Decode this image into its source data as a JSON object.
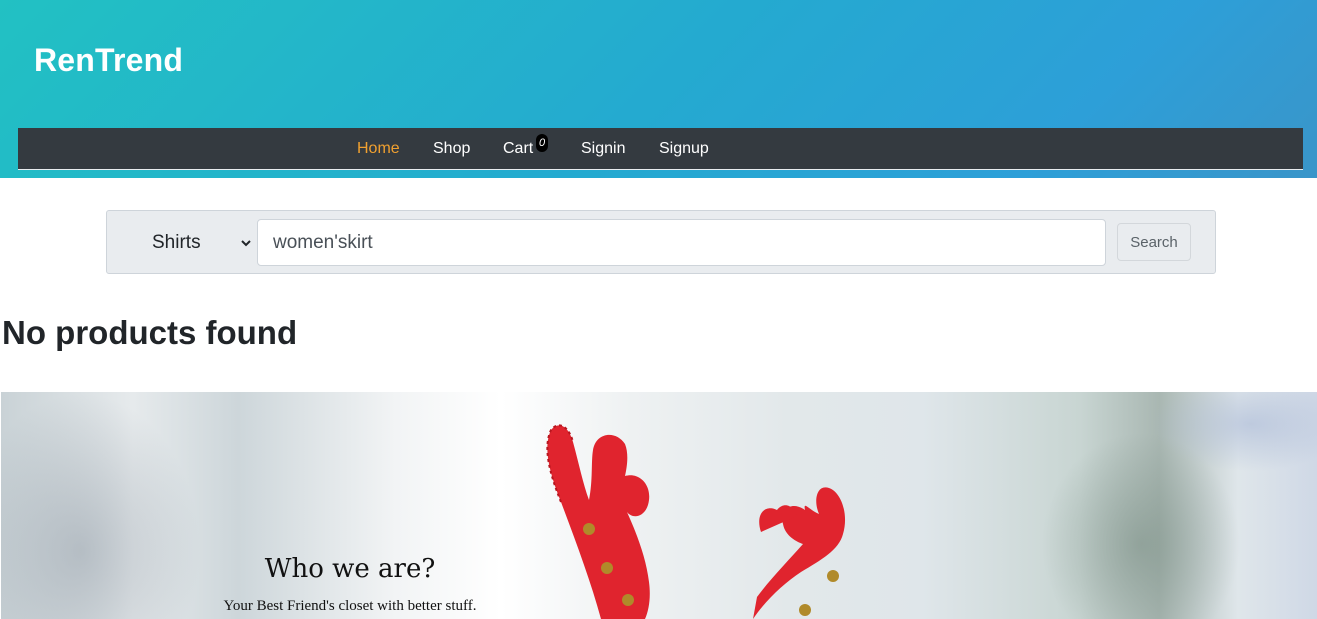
{
  "brand": {
    "name": "RenTrend"
  },
  "nav": {
    "items": [
      {
        "label": "Home",
        "active": true
      },
      {
        "label": "Shop"
      },
      {
        "label": "Cart"
      },
      {
        "label": "Signin"
      },
      {
        "label": "Signup"
      }
    ],
    "cart_count": "0"
  },
  "search": {
    "category": "Shirts",
    "query": "women'skirt",
    "button_label": "Search"
  },
  "results": {
    "message": "No products found"
  },
  "hero": {
    "title": "Who we are?",
    "subtitle": "Your Best Friend's closet with better stuff."
  },
  "colors": {
    "header_gradient_start": "#22c1c3",
    "header_gradient_end": "#3a95c9",
    "navbar_bg": "#343a40",
    "nav_active": "#f0a030"
  }
}
